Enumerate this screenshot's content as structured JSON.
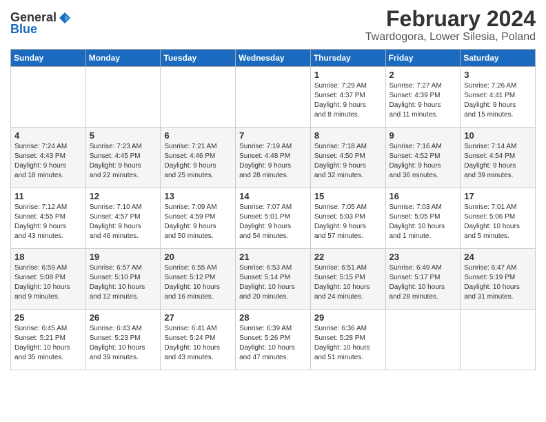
{
  "logo": {
    "general": "General",
    "blue": "Blue"
  },
  "title": "February 2024",
  "subtitle": "Twardogora, Lower Silesia, Poland",
  "days_of_week": [
    "Sunday",
    "Monday",
    "Tuesday",
    "Wednesday",
    "Thursday",
    "Friday",
    "Saturday"
  ],
  "weeks": [
    [
      {
        "day": "",
        "info": ""
      },
      {
        "day": "",
        "info": ""
      },
      {
        "day": "",
        "info": ""
      },
      {
        "day": "",
        "info": ""
      },
      {
        "day": "1",
        "info": "Sunrise: 7:29 AM\nSunset: 4:37 PM\nDaylight: 9 hours\nand 8 minutes."
      },
      {
        "day": "2",
        "info": "Sunrise: 7:27 AM\nSunset: 4:39 PM\nDaylight: 9 hours\nand 11 minutes."
      },
      {
        "day": "3",
        "info": "Sunrise: 7:26 AM\nSunset: 4:41 PM\nDaylight: 9 hours\nand 15 minutes."
      }
    ],
    [
      {
        "day": "4",
        "info": "Sunrise: 7:24 AM\nSunset: 4:43 PM\nDaylight: 9 hours\nand 18 minutes."
      },
      {
        "day": "5",
        "info": "Sunrise: 7:23 AM\nSunset: 4:45 PM\nDaylight: 9 hours\nand 22 minutes."
      },
      {
        "day": "6",
        "info": "Sunrise: 7:21 AM\nSunset: 4:46 PM\nDaylight: 9 hours\nand 25 minutes."
      },
      {
        "day": "7",
        "info": "Sunrise: 7:19 AM\nSunset: 4:48 PM\nDaylight: 9 hours\nand 28 minutes."
      },
      {
        "day": "8",
        "info": "Sunrise: 7:18 AM\nSunset: 4:50 PM\nDaylight: 9 hours\nand 32 minutes."
      },
      {
        "day": "9",
        "info": "Sunrise: 7:16 AM\nSunset: 4:52 PM\nDaylight: 9 hours\nand 36 minutes."
      },
      {
        "day": "10",
        "info": "Sunrise: 7:14 AM\nSunset: 4:54 PM\nDaylight: 9 hours\nand 39 minutes."
      }
    ],
    [
      {
        "day": "11",
        "info": "Sunrise: 7:12 AM\nSunset: 4:55 PM\nDaylight: 9 hours\nand 43 minutes."
      },
      {
        "day": "12",
        "info": "Sunrise: 7:10 AM\nSunset: 4:57 PM\nDaylight: 9 hours\nand 46 minutes."
      },
      {
        "day": "13",
        "info": "Sunrise: 7:09 AM\nSunset: 4:59 PM\nDaylight: 9 hours\nand 50 minutes."
      },
      {
        "day": "14",
        "info": "Sunrise: 7:07 AM\nSunset: 5:01 PM\nDaylight: 9 hours\nand 54 minutes."
      },
      {
        "day": "15",
        "info": "Sunrise: 7:05 AM\nSunset: 5:03 PM\nDaylight: 9 hours\nand 57 minutes."
      },
      {
        "day": "16",
        "info": "Sunrise: 7:03 AM\nSunset: 5:05 PM\nDaylight: 10 hours\nand 1 minute."
      },
      {
        "day": "17",
        "info": "Sunrise: 7:01 AM\nSunset: 5:06 PM\nDaylight: 10 hours\nand 5 minutes."
      }
    ],
    [
      {
        "day": "18",
        "info": "Sunrise: 6:59 AM\nSunset: 5:08 PM\nDaylight: 10 hours\nand 9 minutes."
      },
      {
        "day": "19",
        "info": "Sunrise: 6:57 AM\nSunset: 5:10 PM\nDaylight: 10 hours\nand 12 minutes."
      },
      {
        "day": "20",
        "info": "Sunrise: 6:55 AM\nSunset: 5:12 PM\nDaylight: 10 hours\nand 16 minutes."
      },
      {
        "day": "21",
        "info": "Sunrise: 6:53 AM\nSunset: 5:14 PM\nDaylight: 10 hours\nand 20 minutes."
      },
      {
        "day": "22",
        "info": "Sunrise: 6:51 AM\nSunset: 5:15 PM\nDaylight: 10 hours\nand 24 minutes."
      },
      {
        "day": "23",
        "info": "Sunrise: 6:49 AM\nSunset: 5:17 PM\nDaylight: 10 hours\nand 28 minutes."
      },
      {
        "day": "24",
        "info": "Sunrise: 6:47 AM\nSunset: 5:19 PM\nDaylight: 10 hours\nand 31 minutes."
      }
    ],
    [
      {
        "day": "25",
        "info": "Sunrise: 6:45 AM\nSunset: 5:21 PM\nDaylight: 10 hours\nand 35 minutes."
      },
      {
        "day": "26",
        "info": "Sunrise: 6:43 AM\nSunset: 5:23 PM\nDaylight: 10 hours\nand 39 minutes."
      },
      {
        "day": "27",
        "info": "Sunrise: 6:41 AM\nSunset: 5:24 PM\nDaylight: 10 hours\nand 43 minutes."
      },
      {
        "day": "28",
        "info": "Sunrise: 6:39 AM\nSunset: 5:26 PM\nDaylight: 10 hours\nand 47 minutes."
      },
      {
        "day": "29",
        "info": "Sunrise: 6:36 AM\nSunset: 5:28 PM\nDaylight: 10 hours\nand 51 minutes."
      },
      {
        "day": "",
        "info": ""
      },
      {
        "day": "",
        "info": ""
      }
    ]
  ]
}
